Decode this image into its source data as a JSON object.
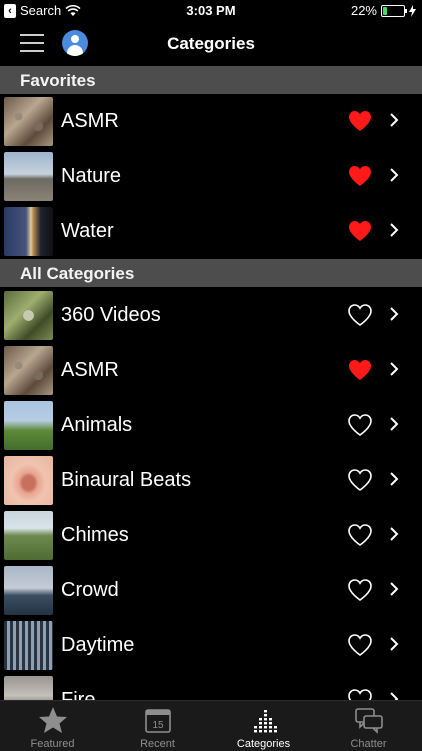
{
  "status_bar": {
    "back_app": "Search",
    "time": "3:03 PM",
    "battery": "22%",
    "battery_level": 0.22
  },
  "navbar": {
    "title": "Categories"
  },
  "sections": {
    "favorites": "Favorites",
    "all": "All Categories"
  },
  "favorites": [
    {
      "label": "ASMR",
      "favorite": true,
      "thumb": "asmr"
    },
    {
      "label": "Nature",
      "favorite": true,
      "thumb": "nature"
    },
    {
      "label": "Water",
      "favorite": true,
      "thumb": "water"
    }
  ],
  "categories": [
    {
      "label": "360 Videos",
      "favorite": false,
      "thumb": "360"
    },
    {
      "label": "ASMR",
      "favorite": true,
      "thumb": "asmr"
    },
    {
      "label": "Animals",
      "favorite": false,
      "thumb": "animals"
    },
    {
      "label": "Binaural Beats",
      "favorite": false,
      "thumb": "binaural"
    },
    {
      "label": "Chimes",
      "favorite": false,
      "thumb": "chimes"
    },
    {
      "label": "Crowd",
      "favorite": false,
      "thumb": "crowd"
    },
    {
      "label": "Daytime",
      "favorite": false,
      "thumb": "daytime"
    },
    {
      "label": "Fire",
      "favorite": false,
      "thumb": "fire"
    }
  ],
  "tabs": [
    {
      "label": "Featured",
      "icon": "star-icon",
      "active": false
    },
    {
      "label": "Recent",
      "icon": "calendar-icon",
      "active": false,
      "badge": "15"
    },
    {
      "label": "Categories",
      "icon": "equalizer-icon",
      "active": true
    },
    {
      "label": "Chatter",
      "icon": "chat-bubbles-icon",
      "active": false
    }
  ],
  "colors": {
    "background": "#000000",
    "section_header": "#4d4d4d",
    "heart_red": "#ff1a1a",
    "tabbar": "#1a1a1a",
    "inactive_tab": "#8e8e8e"
  }
}
